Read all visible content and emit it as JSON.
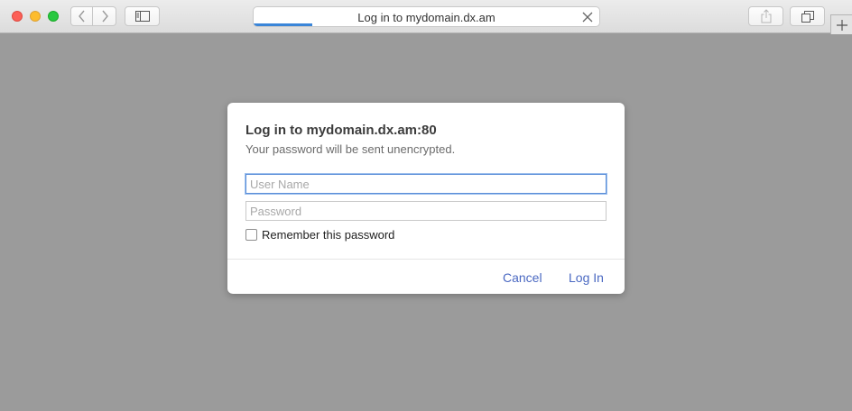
{
  "window": {
    "tab_title": "Log in to mydomain.dx.am",
    "load_progress_percent": 17
  },
  "dialog": {
    "title": "Log in to mydomain.dx.am:80",
    "subtitle": "Your password will be sent unencrypted.",
    "username_placeholder": "User Name",
    "username_value": "",
    "password_placeholder": "Password",
    "password_value": "",
    "remember_label": "Remember this password",
    "remember_checked": false,
    "cancel_label": "Cancel",
    "login_label": "Log In"
  },
  "colors": {
    "accent": "#4b69c2",
    "progress": "#3a85d8",
    "backdrop": "#9b9b9b"
  },
  "icons": {
    "back": "chevron-left-icon",
    "forward": "chevron-right-icon",
    "sidebar": "sidebar-icon",
    "share": "share-icon",
    "tabs": "tabs-overview-icon",
    "close": "close-icon",
    "new_tab": "plus-icon"
  }
}
